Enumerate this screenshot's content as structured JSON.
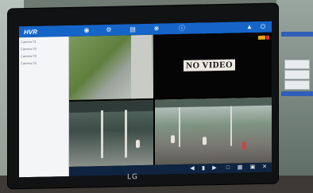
{
  "app": {
    "logo": "HVR"
  },
  "toolbar": {
    "icons": [
      "camera-icon",
      "settings-icon",
      "playback-icon",
      "gear-icon",
      "info-icon",
      "user-icon",
      "power-icon"
    ]
  },
  "sidebar": {
    "items": [
      "Camera 01",
      "Camera 02",
      "Camera 03",
      "Camera 04"
    ]
  },
  "grid": {
    "channel2_overlay": "NO VIDEO"
  },
  "bottom_bar": {
    "icons": [
      "prev-icon",
      "play-icon",
      "next-icon",
      "layout-icon",
      "grid-icon",
      "fullscreen-icon",
      "close-icon"
    ]
  },
  "monitor": {
    "brand": "LG"
  },
  "colors": {
    "accent": "#1565c8",
    "sidebar_bg": "#f4f5f7",
    "rec_indicator": "#e0a31a"
  }
}
